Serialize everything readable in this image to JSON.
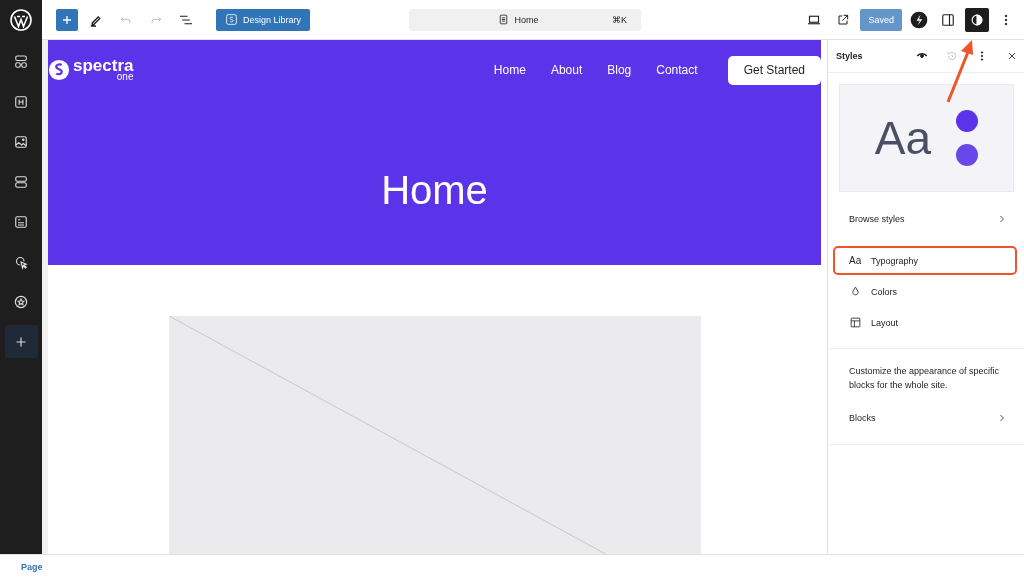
{
  "toolbar": {
    "library_button": "Design Library",
    "command_bar": {
      "title": "Home",
      "shortcut": "⌘K"
    },
    "save_button": {
      "label": "Saved",
      "disabled": true
    },
    "styles_toggle": {
      "selected": true
    }
  },
  "sidebar": {
    "items": [
      {
        "kind": "patterns",
        "selected": false
      },
      {
        "kind": "heading",
        "selected": false
      },
      {
        "kind": "image",
        "selected": false
      },
      {
        "kind": "stack",
        "selected": false
      },
      {
        "kind": "post",
        "selected": false
      },
      {
        "kind": "click",
        "selected": false
      },
      {
        "kind": "star",
        "selected": false
      },
      {
        "kind": "add",
        "selected": true
      }
    ]
  },
  "site_header": {
    "logo": "spectra",
    "logo_sub": "one",
    "nav": [
      "Home",
      "About",
      "Blog",
      "Contact"
    ],
    "cta": "Get Started",
    "hero_title": "Home"
  },
  "styles_panel": {
    "title": "Styles",
    "preview_text": "Aa",
    "preview_swatches": [
      {
        "color": "#5b34ea"
      },
      {
        "color": "#6a47e8"
      }
    ],
    "browse": "Browse styles",
    "items": [
      {
        "kind": "typography",
        "icon_text": "Aa",
        "label": "Typography",
        "highlighted": true
      },
      {
        "kind": "colors",
        "label": "Colors",
        "highlighted": false
      },
      {
        "kind": "layout",
        "label": "Layout",
        "highlighted": false
      }
    ],
    "description": "Customize the appearance of specific blocks for the whole site.",
    "blocks": "Blocks"
  },
  "annotation_arrow": true,
  "status_bar": {
    "breadcrumb": "Page"
  }
}
